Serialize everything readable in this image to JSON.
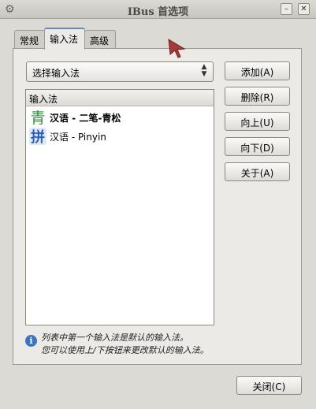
{
  "window": {
    "title": "IBus 首选项"
  },
  "tabs": [
    {
      "label": "常规"
    },
    {
      "label": "输入法",
      "active": true
    },
    {
      "label": "高级"
    }
  ],
  "input_method_select": {
    "selected": "选择输入法"
  },
  "list": {
    "header": "输入法",
    "items": [
      {
        "icon_glyph": "青",
        "label": "汉语 - 二笔-青松",
        "icon_color": "#2e8a3e"
      },
      {
        "icon_glyph": "拼",
        "label": "汉语 - Pinyin",
        "icon_color": "#2b5fb8"
      }
    ]
  },
  "buttons": {
    "add": "添加(A)",
    "remove": "删除(R)",
    "up": "向上(U)",
    "down": "向下(D)",
    "about": "关于(A)",
    "close": "关闭(C)"
  },
  "info": {
    "line1": "列表中第一个输入法是默认的输入法。",
    "line2": "您可以使用上/下按钮来更改默认的输入法。"
  },
  "colors": {
    "accent": "#6a87b7",
    "info_icon": "#3c74c0"
  }
}
